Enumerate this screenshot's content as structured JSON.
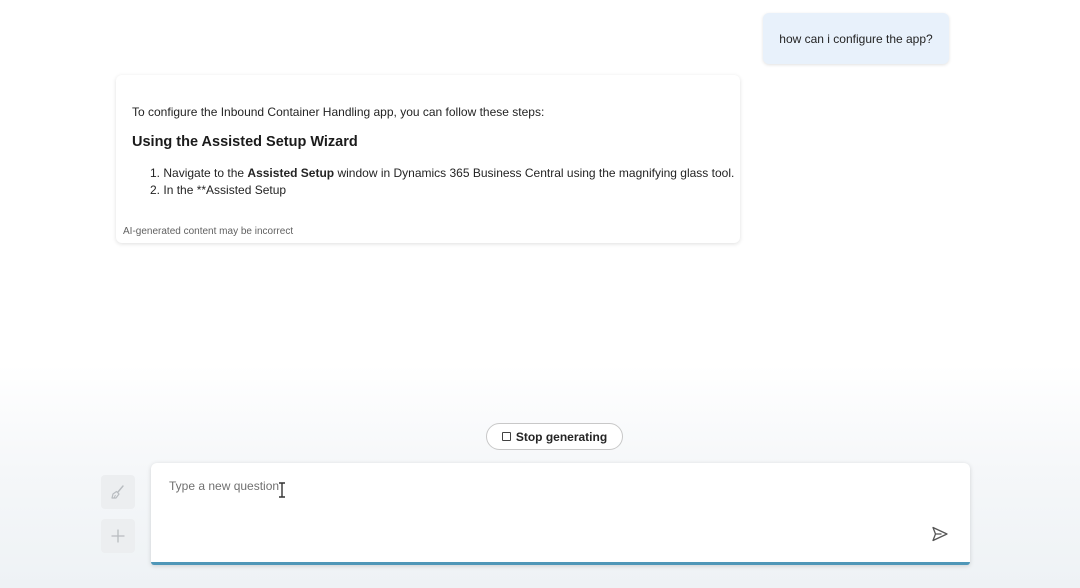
{
  "conversation": {
    "user_message": "how can i configure the app?",
    "assistant": {
      "intro": "To configure the Inbound Container Handling app, you can follow these steps:",
      "heading": "Using the Assisted Setup Wizard",
      "steps": [
        {
          "number": "1.",
          "prefix": "Navigate to the ",
          "bold": "Assisted Setup",
          "suffix": " window in Dynamics 365 Business Central using the magnifying glass tool."
        },
        {
          "number": "2.",
          "text": "In the **Assisted Setup"
        }
      ],
      "disclaimer": "AI-generated content may be incorrect"
    }
  },
  "controls": {
    "stop_label": "Stop generating",
    "input_placeholder": "Type a new question",
    "clear_icon": "broom-icon",
    "add_icon": "plus-icon",
    "send_icon": "send-icon"
  },
  "colors": {
    "user_bubble": "#e8f1fb",
    "input_accent": "#4f97b8"
  }
}
